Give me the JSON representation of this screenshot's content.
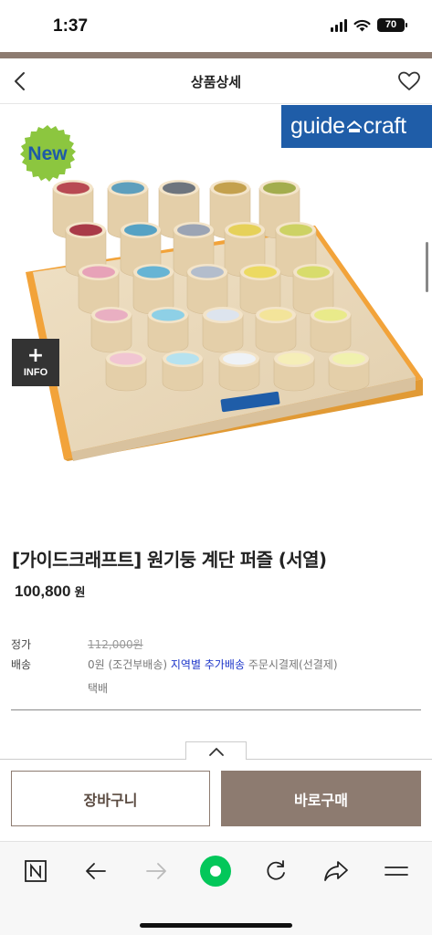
{
  "status_bar": {
    "time": "1:37",
    "battery": "70"
  },
  "header": {
    "title": "상품상세"
  },
  "product_image": {
    "new_badge": "New",
    "brand_logo_left": "guide",
    "brand_logo_right": "craft",
    "info_button": {
      "plus": "+",
      "label": "INFO"
    }
  },
  "product": {
    "name": "[가이드크래프트] 원기둥 계단 퍼즐 (서열)",
    "price": "100,800",
    "price_unit": "원"
  },
  "details": {
    "list_price_label": "정가",
    "list_price_value": "112,000원",
    "shipping_label": "배송",
    "shipping_fee": "0원 (조건부배송)",
    "shipping_region": "지역별 추가배송",
    "shipping_payment": "주문시결제(선결제)",
    "shipping_method": "택배"
  },
  "buy_bar": {
    "cart_label": "장바구니",
    "buy_label": "바로구매"
  },
  "browser_toolbar": {
    "icons": [
      "naver-n-icon",
      "back-arrow-icon",
      "forward-arrow-icon",
      "green-dot-icon",
      "refresh-icon",
      "share-icon",
      "menu-icon"
    ]
  },
  "colors": {
    "brand_brown": "#8d7b70",
    "logo_blue": "#1f5da8",
    "new_badge_green": "#8cc63f",
    "naver_green": "#03c75a",
    "link_blue": "#1c35c9"
  }
}
